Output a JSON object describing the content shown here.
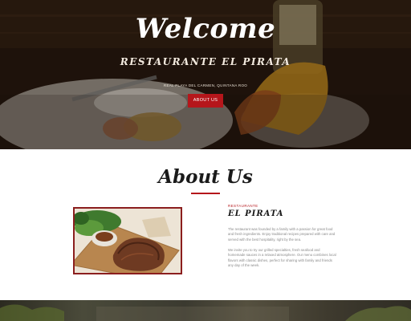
{
  "hero": {
    "title": "Welcome",
    "subtitle": "RESTAURANTE EL PIRATA",
    "address": "REAL PLAYA DEL CARMEN, QUINTANA ROO",
    "button_label": "ABOUT US"
  },
  "about": {
    "title": "About Us",
    "kicker": "RESTAURANTE",
    "sub_title": "EL PIRATA",
    "paragraph1": "The restaurant was founded by a family with a passion for great food and fresh ingredients. Enjoy traditional recipes prepared with care and served with the best hospitality, right by the sea.",
    "paragraph2": "We invite you to try our grilled specialties, fresh seafood and homemade sauces in a relaxed atmosphere. Our menu combines local flavors with classic dishes, perfect for sharing with family and friends any day of the week."
  },
  "colors": {
    "accent": "#b5161b",
    "hero_dark": "#1c120c"
  }
}
